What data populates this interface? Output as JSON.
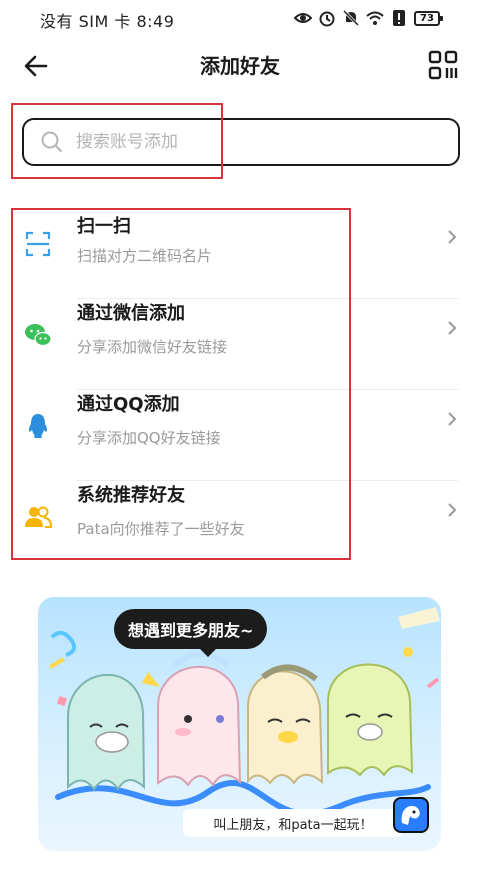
{
  "status_bar": {
    "left_text": "没有 SIM 卡 8:49",
    "battery": "73"
  },
  "header": {
    "title": "添加好友"
  },
  "search": {
    "placeholder": "搜索账号添加"
  },
  "items": [
    {
      "title": "扫一扫",
      "subtitle": "扫描对方二维码名片",
      "icon": "scan-icon"
    },
    {
      "title": "通过微信添加",
      "subtitle": "分享添加微信好友链接",
      "icon": "wechat-icon"
    },
    {
      "title": "通过QQ添加",
      "subtitle": "分享添加QQ好友链接",
      "icon": "qq-penguin-icon"
    },
    {
      "title": "系统推荐好友",
      "subtitle": "Pata向你推荐了一些好友",
      "icon": "users-icon"
    }
  ],
  "banner": {
    "bubble": "想遇到更多朋友~",
    "cta": "叫上朋友，和pata一起玩！"
  },
  "colors": {
    "annotation": "#d8333b",
    "scan": "#3aa0e8",
    "wechat": "#3cc05a",
    "qq": "#2d8ee0",
    "users": "#f5b400"
  }
}
